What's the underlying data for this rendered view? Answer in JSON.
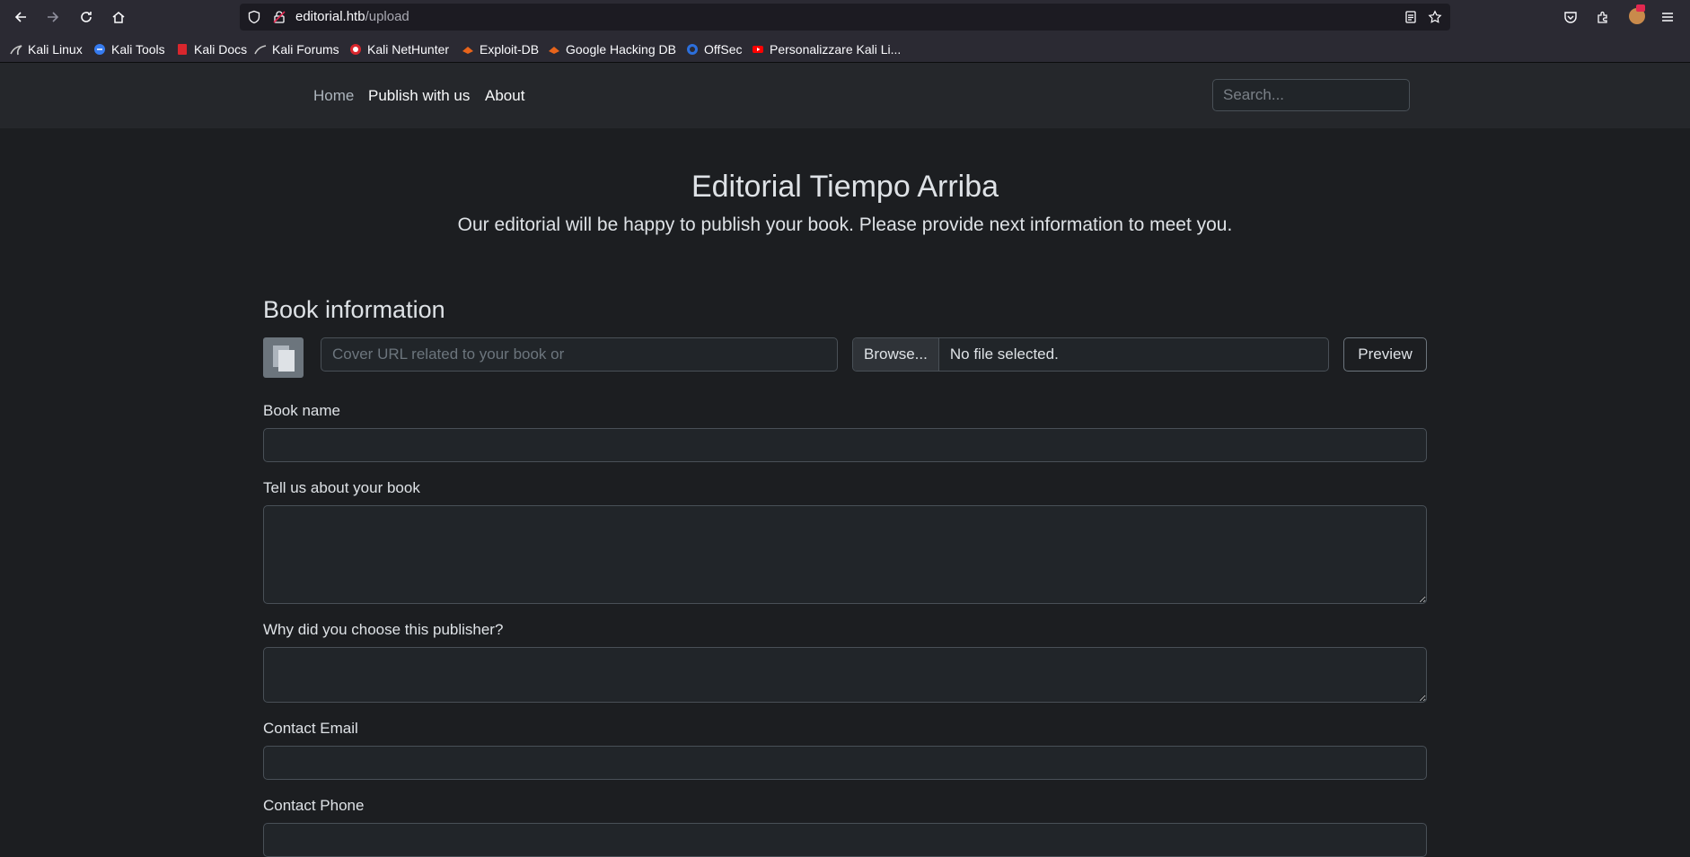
{
  "browser": {
    "url_host": "editorial.htb",
    "url_path": "/upload",
    "bookmarks": [
      {
        "label": "Kali Linux",
        "icon": "kali-dragon-icon"
      },
      {
        "label": "Kali Tools",
        "icon": "kali-tools-icon"
      },
      {
        "label": "Kali Docs",
        "icon": "kali-docs-icon"
      },
      {
        "label": "Kali Forums",
        "icon": "kali-forums-icon"
      },
      {
        "label": "Kali NetHunter",
        "icon": "nethunter-icon"
      },
      {
        "label": "Exploit-DB",
        "icon": "exploit-db-icon"
      },
      {
        "label": "Google Hacking DB",
        "icon": "ghdb-icon"
      },
      {
        "label": "OffSec",
        "icon": "offsec-icon"
      },
      {
        "label": "Personalizzare Kali Li...",
        "icon": "youtube-icon"
      }
    ]
  },
  "navbar": {
    "links": [
      {
        "label": "Home"
      },
      {
        "label": "Publish with us"
      },
      {
        "label": "About"
      }
    ],
    "search_placeholder": "Search..."
  },
  "hero": {
    "title": "Editorial Tiempo Arriba",
    "subtitle": "Our editorial will be happy to publish your book. Please provide next information to meet you."
  },
  "form": {
    "section_title": "Book information",
    "cover_url_placeholder": "Cover URL related to your book or",
    "browse_label": "Browse...",
    "file_status": "No file selected.",
    "preview_label": "Preview",
    "book_name_label": "Book name",
    "about_label": "Tell us about your book",
    "why_label": "Why did you choose this publisher?",
    "email_label": "Contact Email",
    "phone_label": "Contact Phone"
  }
}
